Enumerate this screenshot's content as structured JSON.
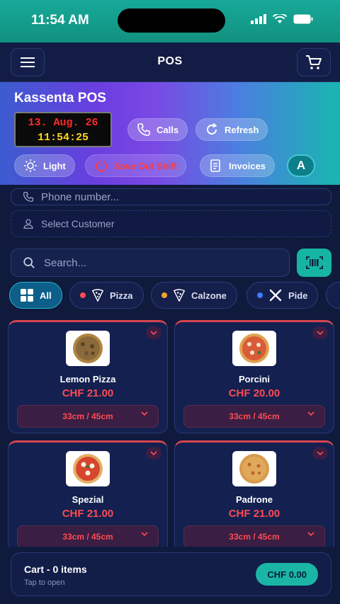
{
  "status_bar": {
    "time": "11:54 AM"
  },
  "app_bar": {
    "title": "POS"
  },
  "hero": {
    "title": "Kassenta POS",
    "clock_date": "13. Aug. 26",
    "clock_time": "11:54:25",
    "buttons": {
      "calls": "Calls",
      "refresh": "Refresh",
      "light": "Light",
      "save_shift": "Save Out Shift",
      "invoices": "Invoices",
      "avatar": "A"
    }
  },
  "customer": {
    "phone_placeholder": "Phone number...",
    "select_label": "Select Customer"
  },
  "search": {
    "placeholder": "Search..."
  },
  "categories": [
    {
      "label": "All",
      "active": true
    },
    {
      "label": "Pizza",
      "color": "#ff4b52"
    },
    {
      "label": "Calzone",
      "color": "#f4a52a"
    },
    {
      "label": "Pide",
      "color": "#3b7cff"
    }
  ],
  "products": [
    {
      "name": "Lemon Pizza",
      "price": "CHF 21.00",
      "size": "33cm / 45cm"
    },
    {
      "name": "Porcini",
      "price": "CHF 20.00",
      "size": "33cm / 45cm"
    },
    {
      "name": "Spezial",
      "price": "CHF 21.00",
      "size": "33cm / 45cm"
    },
    {
      "name": "Padrone",
      "price": "CHF 21.00",
      "size": "33cm / 45cm"
    }
  ],
  "cart": {
    "title": "Cart - 0 items",
    "subtitle": "Tap to open",
    "total": "CHF 0.00"
  },
  "colors": {
    "accent": "#16b5a3",
    "price": "#ff4b52",
    "background": "#0f1a3d"
  }
}
